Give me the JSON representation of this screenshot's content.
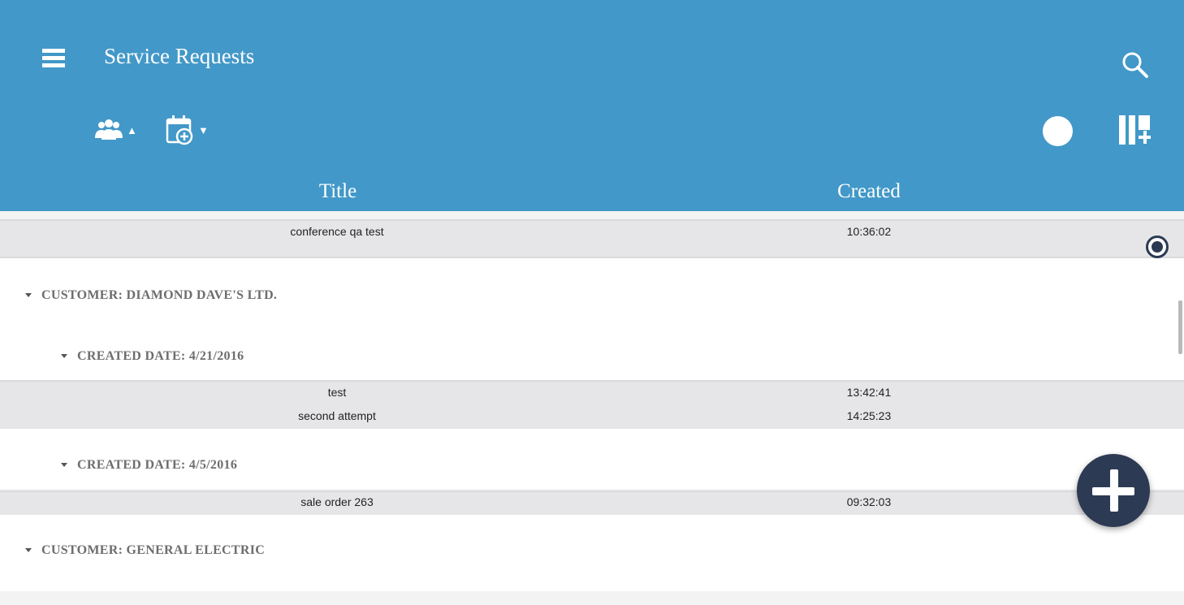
{
  "header": {
    "title": "Service Requests",
    "icons": [
      "menu-icon",
      "search-icon",
      "group-icon",
      "calendar-add-icon",
      "record-icon",
      "column-manager-icon"
    ],
    "background": "#4298c8"
  },
  "columns": [
    "Title",
    "Created"
  ],
  "rows": [
    {
      "title": "conference qa test",
      "created": "10:36:02"
    },
    {
      "title": "test",
      "created": "13:42:41"
    },
    {
      "title": "second attempt",
      "created": "14:25:23"
    },
    {
      "title": "sale order 263",
      "created": "09:32:03"
    }
  ],
  "groups": [
    "CUSTOMER: DIAMOND DAVE'S LTD.",
    "CREATED DATE: 4/21/2016",
    "CREATED DATE: 4/5/2016",
    "CUSTOMER: GENERAL ELECTRIC"
  ],
  "accent": "#2c3a53"
}
